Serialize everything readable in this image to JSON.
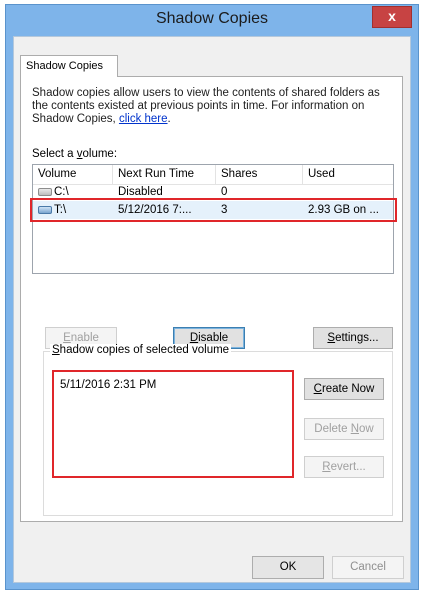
{
  "window": {
    "title": "Shadow Copies",
    "close_label": "x"
  },
  "tabs": [
    {
      "label": "Shadow Copies"
    }
  ],
  "description": {
    "text": "Shadow copies allow users to view the contents of shared folders as the contents existed at previous points in time. For information on Shadow Copies, ",
    "link": "click here",
    "end": "."
  },
  "volumes": {
    "label_pre": "Select a ",
    "label_key": "v",
    "label_post": "olume:",
    "columns": [
      "Volume",
      "Next Run Time",
      "Shares",
      "Used"
    ],
    "rows": [
      {
        "volume": "C:\\",
        "next_run": "Disabled",
        "shares": "0",
        "used": "",
        "icon": "drive-icon",
        "selected": false
      },
      {
        "volume": "T:\\",
        "next_run": "5/12/2016 7:...",
        "shares": "3",
        "used": "2.93 GB on ...",
        "icon": "network-drive-icon",
        "selected": true
      }
    ]
  },
  "buttons": {
    "enable": {
      "key": "E",
      "rest": "nable"
    },
    "disable": {
      "key": "D",
      "rest": "isable"
    },
    "settings": {
      "key": "S",
      "rest": "ettings..."
    }
  },
  "snapshots": {
    "label_key": "S",
    "label_rest": "hadow copies of selected volume",
    "items": [
      "5/11/2016 2:31 PM"
    ],
    "create": {
      "key": "C",
      "rest": "reate Now"
    },
    "delete": {
      "pre": "Delete ",
      "key": "N",
      "rest": "ow"
    },
    "revert": {
      "key": "R",
      "rest": "evert..."
    }
  },
  "footer": {
    "ok": "OK",
    "cancel": "Cancel"
  }
}
